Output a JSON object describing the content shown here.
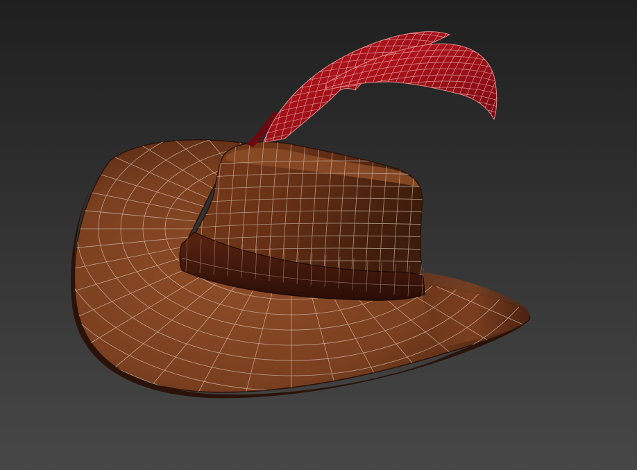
{
  "viewport": {
    "background_top": "#1f1f1f",
    "background_bottom": "#474747"
  },
  "model": {
    "subject": "hat-with-feather",
    "display_mode": "smooth-shaded-with-wireframe",
    "colors": {
      "felt": "#7a3f1f",
      "felt_light": "#8e4c27",
      "felt_dark": "#3e1c0b",
      "band": "#4a1e0e",
      "band_dark": "#2a0d05",
      "feather": "#b0141c",
      "feather_dark": "#6a0a10",
      "wire_felt": "#d9c3b3",
      "wire_feather": "#f3b3b3"
    }
  }
}
